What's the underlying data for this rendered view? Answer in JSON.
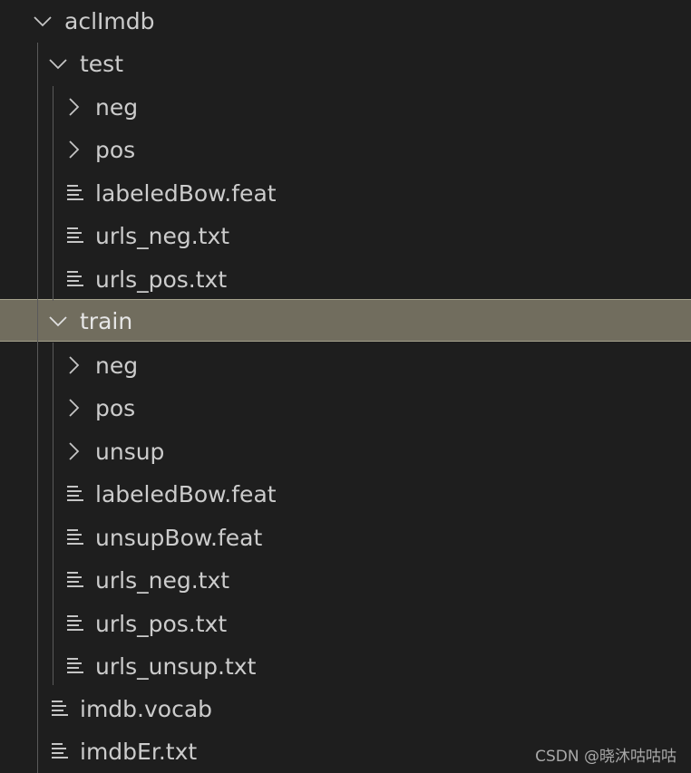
{
  "explorer": {
    "items": [
      {
        "label": "aclImdb",
        "type": "folder",
        "expanded": true,
        "depth": 0
      },
      {
        "label": "test",
        "type": "folder",
        "expanded": true,
        "depth": 1
      },
      {
        "label": "neg",
        "type": "folder",
        "expanded": false,
        "depth": 2
      },
      {
        "label": "pos",
        "type": "folder",
        "expanded": false,
        "depth": 2
      },
      {
        "label": "labeledBow.feat",
        "type": "file",
        "depth": 2
      },
      {
        "label": "urls_neg.txt",
        "type": "file",
        "depth": 2
      },
      {
        "label": "urls_pos.txt",
        "type": "file",
        "depth": 2
      },
      {
        "label": "train",
        "type": "folder",
        "expanded": true,
        "depth": 1,
        "selected": true
      },
      {
        "label": "neg",
        "type": "folder",
        "expanded": false,
        "depth": 2
      },
      {
        "label": "pos",
        "type": "folder",
        "expanded": false,
        "depth": 2
      },
      {
        "label": "unsup",
        "type": "folder",
        "expanded": false,
        "depth": 2
      },
      {
        "label": "labeledBow.feat",
        "type": "file",
        "depth": 2
      },
      {
        "label": "unsupBow.feat",
        "type": "file",
        "depth": 2
      },
      {
        "label": "urls_neg.txt",
        "type": "file",
        "depth": 2
      },
      {
        "label": "urls_pos.txt",
        "type": "file",
        "depth": 2
      },
      {
        "label": "urls_unsup.txt",
        "type": "file",
        "depth": 2
      },
      {
        "label": "imdb.vocab",
        "type": "file",
        "depth": 1
      },
      {
        "label": "imdbEr.txt",
        "type": "file",
        "depth": 1
      }
    ]
  },
  "watermark": "CSDN @晓沐咕咕咕",
  "colors": {
    "background": "#1e1e1e",
    "selected_row": "#716d5e",
    "text": "#cccccc"
  }
}
